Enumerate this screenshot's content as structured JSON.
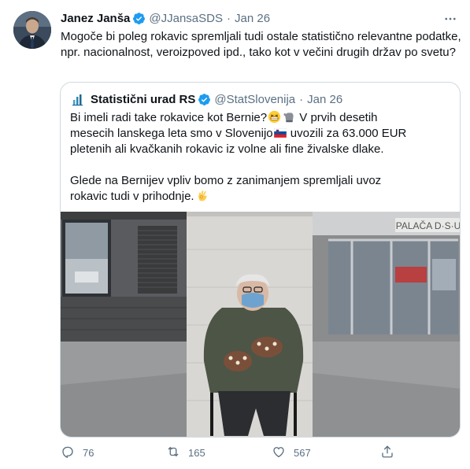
{
  "author": {
    "name": "Janez Janša",
    "handle": "@JJansaSDS",
    "separator": "·",
    "date": "Jan 26",
    "verified_icon": "verified-badge-icon",
    "accent_color": "#1d9bf0"
  },
  "tweet_text": "Mogoče bi poleg rokavic spremljali tudi ostale statistično relevantne podatke, npr. nacionalnost, veroizpoved ipd., tako kot v večini drugih držav po svetu?",
  "quoted": {
    "name": "Statistični urad RS",
    "handle": "@StatSlovenija",
    "separator": "·",
    "date": "Jan 26",
    "para1": {
      "l1a": "Bi imeli radi take rokavice kot Bernie?",
      "l1b": " V prvih desetih",
      "l2a": "mesecih lanskega leta smo v Slovenijo",
      "l2b": " uvozili za 63.000 EUR",
      "l3": "pletenih ali kvačkanih rokavic iz volne ali fine živalske dlake."
    },
    "para2": {
      "l1": "Glede na Bernijev vpliv bomo z zanimanjem spremljali uvoz",
      "l2": "rokavic tudi v prihodnje."
    },
    "photo_sign": "PALAČA D·S·U"
  },
  "actions": {
    "reply_count": "76",
    "retweet_count": "165",
    "like_count": "567"
  }
}
